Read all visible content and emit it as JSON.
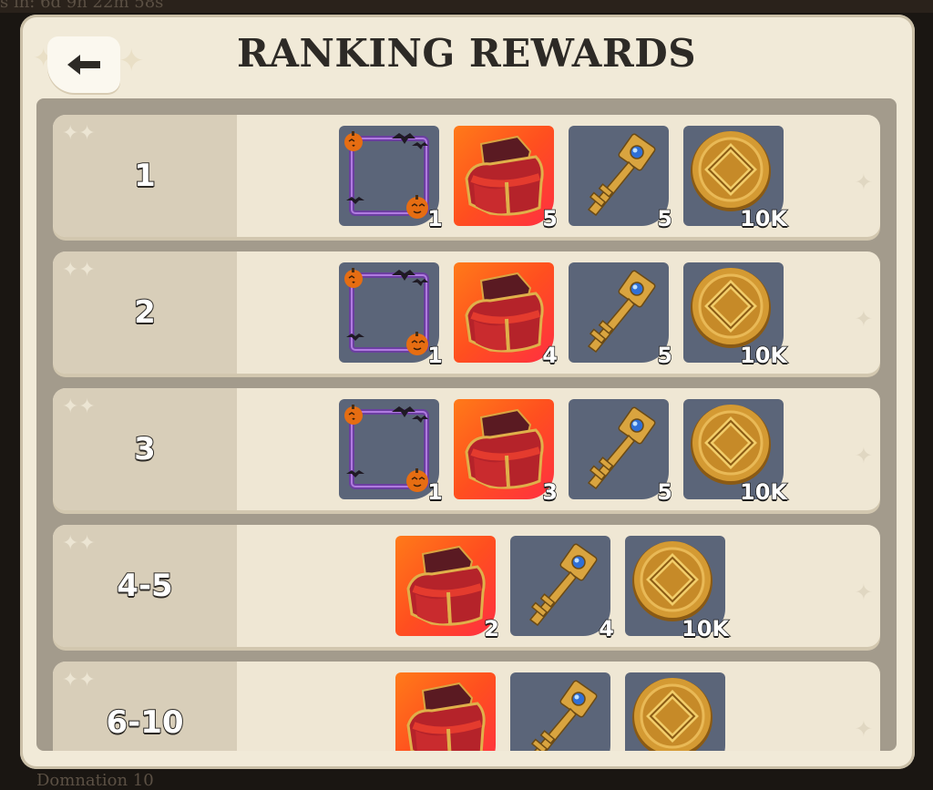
{
  "background": {
    "top_text": "s in: 6d 9h 22m 58s",
    "bottom_text": "Domnation 10"
  },
  "header": {
    "title": "RANKING REWARDS",
    "back_icon": "back-arrow-icon"
  },
  "rewards": [
    {
      "rank": "1",
      "items": [
        {
          "icon": "halloween-frame-icon",
          "qty": "1"
        },
        {
          "icon": "red-chest-icon",
          "qty": "5"
        },
        {
          "icon": "golden-key-icon",
          "qty": "5"
        },
        {
          "icon": "gold-coin-icon",
          "qty": "10K"
        }
      ]
    },
    {
      "rank": "2",
      "items": [
        {
          "icon": "halloween-frame-icon",
          "qty": "1"
        },
        {
          "icon": "red-chest-icon",
          "qty": "4"
        },
        {
          "icon": "golden-key-icon",
          "qty": "5"
        },
        {
          "icon": "gold-coin-icon",
          "qty": "10K"
        }
      ]
    },
    {
      "rank": "3",
      "items": [
        {
          "icon": "halloween-frame-icon",
          "qty": "1"
        },
        {
          "icon": "red-chest-icon",
          "qty": "3"
        },
        {
          "icon": "golden-key-icon",
          "qty": "5"
        },
        {
          "icon": "gold-coin-icon",
          "qty": "10K"
        }
      ]
    },
    {
      "rank": "4-5",
      "items": [
        {
          "icon": "red-chest-icon",
          "qty": "2"
        },
        {
          "icon": "golden-key-icon",
          "qty": "4"
        },
        {
          "icon": "gold-coin-icon",
          "qty": "10K"
        }
      ]
    },
    {
      "rank": "6-10",
      "items": [
        {
          "icon": "red-chest-icon",
          "qty": ""
        },
        {
          "icon": "golden-key-icon",
          "qty": ""
        },
        {
          "icon": "gold-coin-icon",
          "qty": ""
        }
      ]
    }
  ],
  "colors": {
    "panel": "#f1ead8",
    "row": "#efe7d4",
    "rank_cell": "#d8ceb9",
    "list_bg": "#a39b8c",
    "item_bg": "#5b6579",
    "chest_bg": "#ff5a1f"
  }
}
